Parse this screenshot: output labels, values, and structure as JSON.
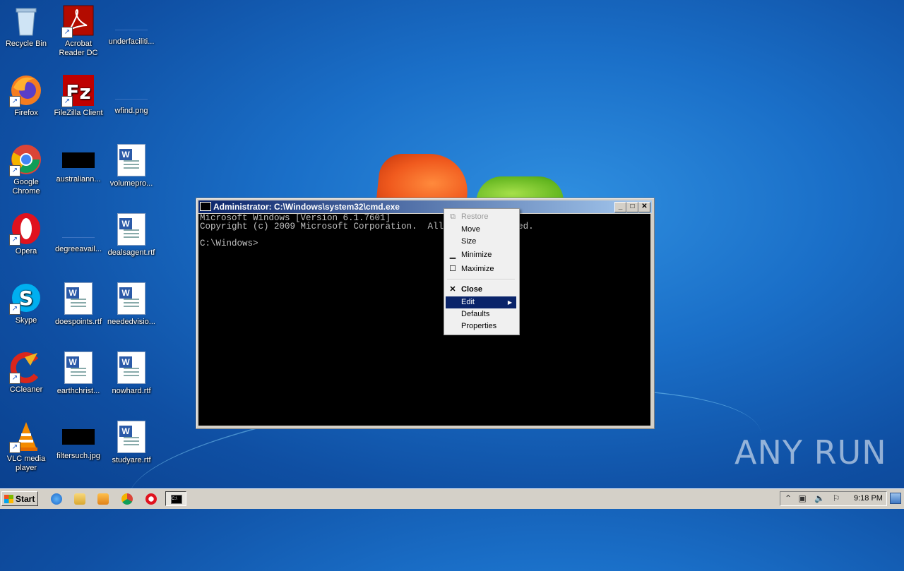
{
  "desktop": {
    "icons": [
      {
        "label": "Recycle Bin"
      },
      {
        "label": "Acrobat Reader DC"
      },
      {
        "label": "underfaciliti..."
      },
      {
        "label": "Firefox"
      },
      {
        "label": "FileZilla Client"
      },
      {
        "label": "wfind.png"
      },
      {
        "label": "Google Chrome"
      },
      {
        "label": "australiann..."
      },
      {
        "label": "volumepro..."
      },
      {
        "label": "Opera"
      },
      {
        "label": "degreeavail..."
      },
      {
        "label": "dealsagent.rtf"
      },
      {
        "label": "Skype"
      },
      {
        "label": "doespoints.rtf"
      },
      {
        "label": "neededvisio..."
      },
      {
        "label": "CCleaner"
      },
      {
        "label": "earthchrist..."
      },
      {
        "label": "nowhard.rtf"
      },
      {
        "label": "VLC media player"
      },
      {
        "label": "filtersuch.jpg"
      },
      {
        "label": "studyare.rtf"
      }
    ]
  },
  "cmd_window": {
    "title": "Administrator: C:\\Windows\\system32\\cmd.exe",
    "lines": [
      "Microsoft Windows [Version 6.1.7601]",
      "Copyright (c) 2009 Microsoft Corporation.  All rights reserved.",
      "",
      "C:\\Windows>"
    ]
  },
  "context_menu": {
    "items": [
      {
        "label": "Restore",
        "disabled": true
      },
      {
        "label": "Move"
      },
      {
        "label": "Size"
      },
      {
        "label": "Minimize"
      },
      {
        "label": "Maximize"
      },
      {
        "label": "Close"
      },
      {
        "label": "Edit",
        "submenu": true,
        "selected": true
      },
      {
        "label": "Defaults"
      },
      {
        "label": "Properties"
      }
    ]
  },
  "taskbar": {
    "start_label": "Start",
    "clock": "9:18 PM"
  },
  "watermark": "ANY RUN"
}
